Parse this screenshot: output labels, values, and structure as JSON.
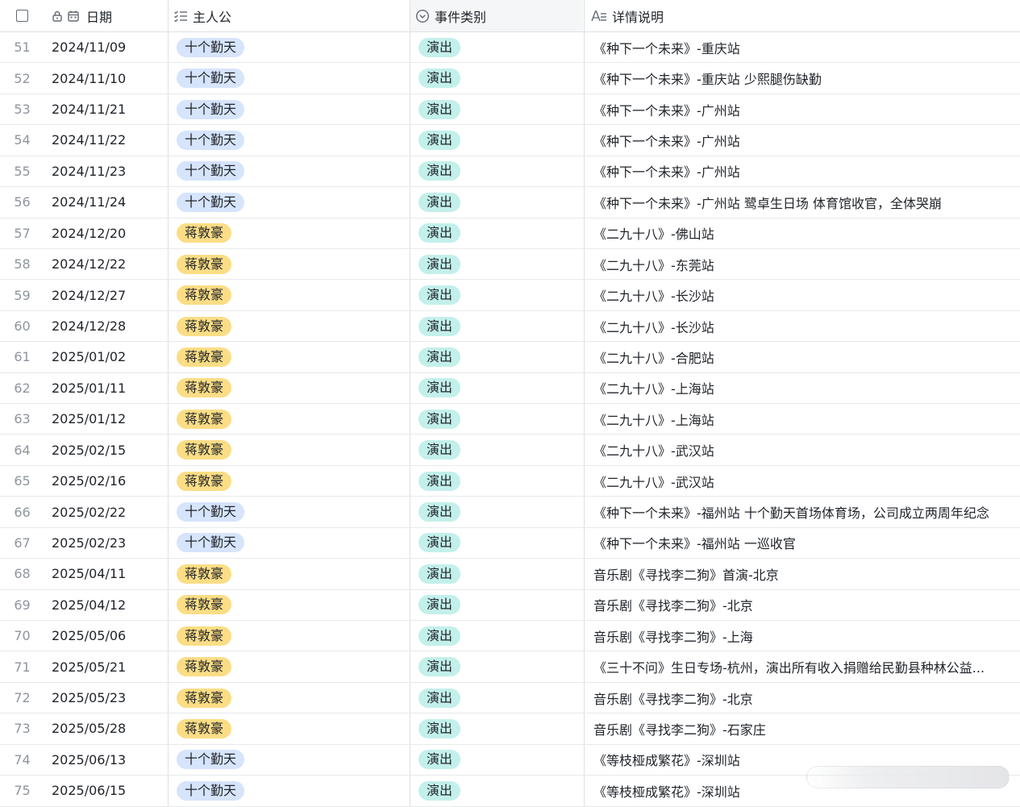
{
  "header": {
    "date_label": "日期",
    "host_label": "主人公",
    "type_label": "事件类别",
    "detail_label": "详情说明"
  },
  "colors": {
    "tag_blue": "#d6e4fc",
    "tag_yellow": "#fbdd85",
    "tag_teal": "#c3f0ea"
  },
  "rows": [
    {
      "num": "51",
      "date": "2024/11/09",
      "host": "十个勤天",
      "host_color": "blue",
      "type": "演出",
      "detail": "《种下一个未来》-重庆站"
    },
    {
      "num": "52",
      "date": "2024/11/10",
      "host": "十个勤天",
      "host_color": "blue",
      "type": "演出",
      "detail": "《种下一个未来》-重庆站 少熙腿伤缺勤"
    },
    {
      "num": "53",
      "date": "2024/11/21",
      "host": "十个勤天",
      "host_color": "blue",
      "type": "演出",
      "detail": "《种下一个未来》-广州站"
    },
    {
      "num": "54",
      "date": "2024/11/22",
      "host": "十个勤天",
      "host_color": "blue",
      "type": "演出",
      "detail": "《种下一个未来》-广州站"
    },
    {
      "num": "55",
      "date": "2024/11/23",
      "host": "十个勤天",
      "host_color": "blue",
      "type": "演出",
      "detail": "《种下一个未来》-广州站"
    },
    {
      "num": "56",
      "date": "2024/11/24",
      "host": "十个勤天",
      "host_color": "blue",
      "type": "演出",
      "detail": "《种下一个未来》-广州站 鹭卓生日场 体育馆收官，全体哭崩"
    },
    {
      "num": "57",
      "date": "2024/12/20",
      "host": "蒋敦豪",
      "host_color": "yellow",
      "type": "演出",
      "detail": "《二九十八》-佛山站"
    },
    {
      "num": "58",
      "date": "2024/12/22",
      "host": "蒋敦豪",
      "host_color": "yellow",
      "type": "演出",
      "detail": "《二九十八》-东莞站"
    },
    {
      "num": "59",
      "date": "2024/12/27",
      "host": "蒋敦豪",
      "host_color": "yellow",
      "type": "演出",
      "detail": "《二九十八》-长沙站"
    },
    {
      "num": "60",
      "date": "2024/12/28",
      "host": "蒋敦豪",
      "host_color": "yellow",
      "type": "演出",
      "detail": "《二九十八》-长沙站"
    },
    {
      "num": "61",
      "date": "2025/01/02",
      "host": "蒋敦豪",
      "host_color": "yellow",
      "type": "演出",
      "detail": "《二九十八》-合肥站"
    },
    {
      "num": "62",
      "date": "2025/01/11",
      "host": "蒋敦豪",
      "host_color": "yellow",
      "type": "演出",
      "detail": "《二九十八》-上海站"
    },
    {
      "num": "63",
      "date": "2025/01/12",
      "host": "蒋敦豪",
      "host_color": "yellow",
      "type": "演出",
      "detail": "《二九十八》-上海站"
    },
    {
      "num": "64",
      "date": "2025/02/15",
      "host": "蒋敦豪",
      "host_color": "yellow",
      "type": "演出",
      "detail": "《二九十八》-武汉站"
    },
    {
      "num": "65",
      "date": "2025/02/16",
      "host": "蒋敦豪",
      "host_color": "yellow",
      "type": "演出",
      "detail": "《二九十八》-武汉站"
    },
    {
      "num": "66",
      "date": "2025/02/22",
      "host": "十个勤天",
      "host_color": "blue",
      "type": "演出",
      "detail": "《种下一个未来》-福州站 十个勤天首场体育场，公司成立两周年纪念"
    },
    {
      "num": "67",
      "date": "2025/02/23",
      "host": "十个勤天",
      "host_color": "blue",
      "type": "演出",
      "detail": "《种下一个未来》-福州站 一巡收官"
    },
    {
      "num": "68",
      "date": "2025/04/11",
      "host": "蒋敦豪",
      "host_color": "yellow",
      "type": "演出",
      "detail": "音乐剧《寻找李二狗》首演-北京"
    },
    {
      "num": "69",
      "date": "2025/04/12",
      "host": "蒋敦豪",
      "host_color": "yellow",
      "type": "演出",
      "detail": "音乐剧《寻找李二狗》-北京"
    },
    {
      "num": "70",
      "date": "2025/05/06",
      "host": "蒋敦豪",
      "host_color": "yellow",
      "type": "演出",
      "detail": "音乐剧《寻找李二狗》-上海"
    },
    {
      "num": "71",
      "date": "2025/05/21",
      "host": "蒋敦豪",
      "host_color": "yellow",
      "type": "演出",
      "detail": "《三十不问》生日专场-杭州，演出所有收入捐赠给民勤县种林公益..."
    },
    {
      "num": "72",
      "date": "2025/05/23",
      "host": "蒋敦豪",
      "host_color": "yellow",
      "type": "演出",
      "detail": "音乐剧《寻找李二狗》-北京"
    },
    {
      "num": "73",
      "date": "2025/05/28",
      "host": "蒋敦豪",
      "host_color": "yellow",
      "type": "演出",
      "detail": "音乐剧《寻找李二狗》-石家庄"
    },
    {
      "num": "74",
      "date": "2025/06/13",
      "host": "十个勤天",
      "host_color": "blue",
      "type": "演出",
      "detail": "《等枝桠成繁花》-深圳站"
    },
    {
      "num": "75",
      "date": "2025/06/15",
      "host": "十个勤天",
      "host_color": "blue",
      "type": "演出",
      "detail": "《等枝桠成繁花》-深圳站"
    }
  ]
}
